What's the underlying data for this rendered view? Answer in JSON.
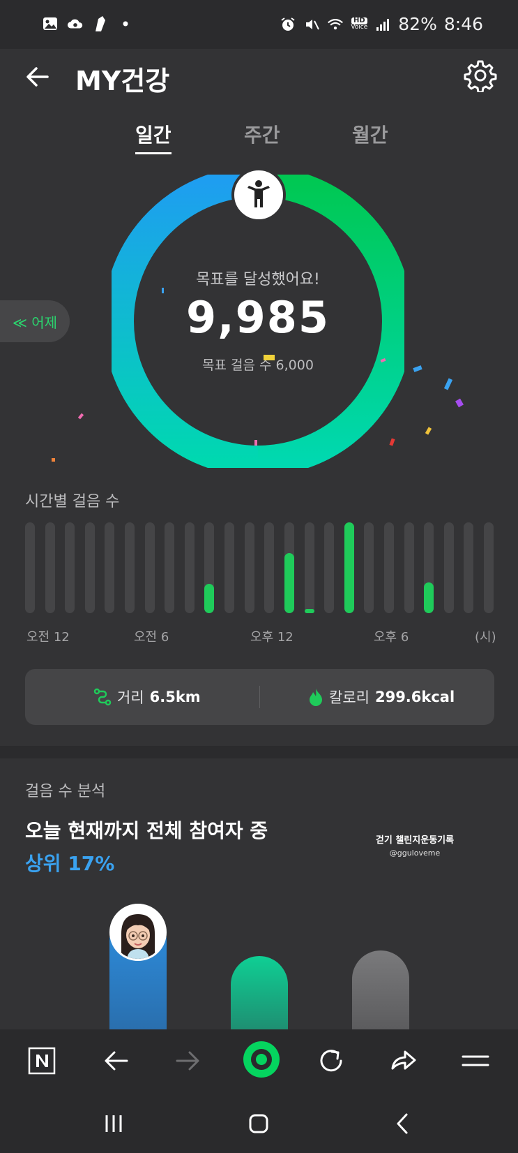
{
  "status_bar": {
    "battery": "82%",
    "time": "8:46",
    "hd_label": "HD",
    "voice_label": "Voice"
  },
  "header": {
    "title": "MY건강"
  },
  "tabs": [
    {
      "label": "일간",
      "active": true
    },
    {
      "label": "주간",
      "active": false
    },
    {
      "label": "월간",
      "active": false
    }
  ],
  "summary": {
    "goal_message": "목표를 달성했어요!",
    "steps": "9,985",
    "goal_label": "목표 걸음 수 6,000",
    "yesterday_label": "≪ 어제",
    "ring_progress": 1.0,
    "ring_colors": [
      "#1da1f2",
      "#00c853",
      "#00d2b4"
    ]
  },
  "hourly": {
    "title": "시간별 걸음 수",
    "fills": [
      0,
      0,
      0,
      0,
      0,
      0,
      0,
      0,
      0,
      0.32,
      0,
      0,
      0,
      0.66,
      0.04,
      0,
      1.0,
      0,
      0,
      0,
      0.34,
      0,
      0,
      0
    ],
    "axis_labels": [
      "오전 12",
      "오전 6",
      "오후 12",
      "오후 6",
      "(시)"
    ]
  },
  "stats": {
    "distance_label": "거리",
    "distance_value": "6.5km",
    "calorie_label": "칼로리",
    "calorie_value": "299.6kcal"
  },
  "analysis": {
    "label": "걸음 수 분석",
    "headline": "오늘 현재까지 전체 참여자 중",
    "rank": "상위 17%",
    "watermark_title": "걷기 챌린지운동기록",
    "watermark_handle": "@gguloveme"
  },
  "colors": {
    "accent_green": "#1fcb5a",
    "accent_blue": "#3aa2f0",
    "background": "#333335"
  }
}
